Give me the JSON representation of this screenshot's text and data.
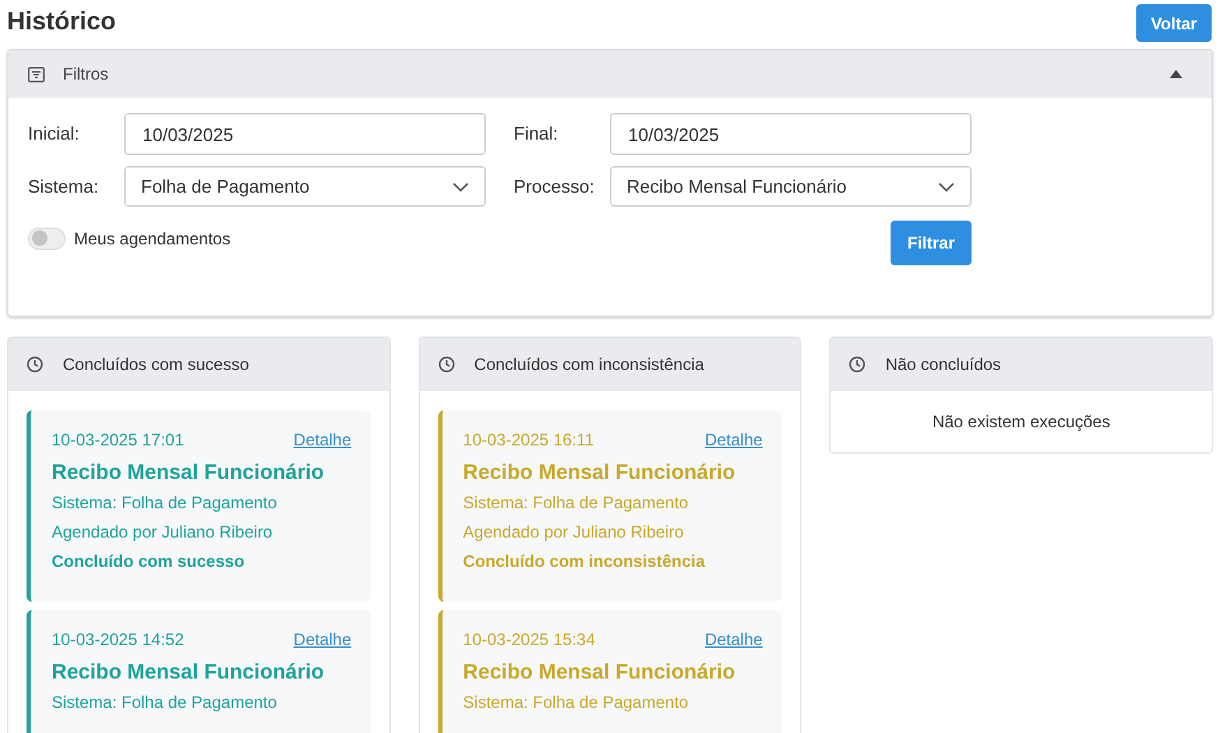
{
  "page": {
    "title": "Histórico",
    "back_button": "Voltar"
  },
  "filters": {
    "title": "Filtros",
    "expanded": true,
    "fields": [
      {
        "label": "Inicial:",
        "value": "10/03/2025",
        "kind": "text"
      },
      {
        "label": "Final:",
        "value": "10/03/2025",
        "kind": "text"
      },
      {
        "label": "Sistema:",
        "value": "Folha de Pagamento",
        "kind": "select"
      },
      {
        "label": "Processo:",
        "value": "Recibo Mensal Funcionário",
        "kind": "select"
      }
    ],
    "toggle": {
      "label": "Meus agendamentos",
      "on": false
    },
    "submit": "Filtrar"
  },
  "columns": [
    {
      "title": "Concluídos com sucesso",
      "color": "#1fa39a",
      "items": [
        {
          "time": "10-03-2025 17:01",
          "link": "Detalhe",
          "process": "Recibo Mensal Funcionário",
          "system": "Sistema: Folha de Pagamento",
          "scheduled_by": "Agendado por Juliano Ribeiro",
          "status": "Concluído com sucesso"
        },
        {
          "time": "10-03-2025 14:52",
          "link": "Detalhe",
          "process": "Recibo Mensal Funcionário",
          "system": "Sistema: Folha de Pagamento"
        }
      ]
    },
    {
      "title": "Concluídos com inconsistência",
      "color": "#c8a92b",
      "items": [
        {
          "time": "10-03-2025 16:11",
          "link": "Detalhe",
          "process": "Recibo Mensal Funcionário",
          "system": "Sistema: Folha de Pagamento",
          "scheduled_by": "Agendado por Juliano Ribeiro",
          "status": "Concluído com inconsistência"
        },
        {
          "time": "10-03-2025 15:34",
          "link": "Detalhe",
          "process": "Recibo Mensal Funcionário",
          "system": "Sistema: Folha de Pagamento"
        }
      ]
    },
    {
      "title": "Não concluídos",
      "empty_message": "Não existem execuções"
    }
  ]
}
